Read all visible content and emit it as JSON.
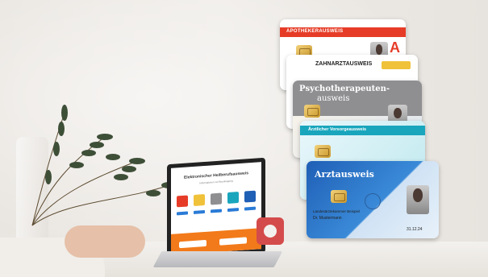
{
  "cards": {
    "apotheker": {
      "title": "APOTHEKERAUSWEIS",
      "logo": "A"
    },
    "zahnarzt": {
      "title": "ZAHNARZTAUSWEIS"
    },
    "psychotherapeut": {
      "title_line1": "Psychotherapeuten-",
      "title_line2": "ausweis"
    },
    "vorsorge": {
      "title": "Ärztlicher Vorsorgeausweis"
    },
    "arzt": {
      "title": "Arztausweis",
      "name_line1": "Landesärztekammer Beispiel",
      "name_line2": "Dr. Mustermann",
      "date": "31.12.24"
    }
  },
  "laptop_screen": {
    "headline": "Elektronischer Heilberufsausweis",
    "subline": "Informationen zur Beantragung"
  },
  "colors": {
    "apotheker_red": "#e63c27",
    "arzt_blue": "#1f5fb6",
    "vorsorge_teal": "#19a6bd",
    "laptop_orange": "#f27a1a"
  },
  "icons": [
    "smartcard-chip-icon",
    "pharmacy-a-icon",
    "caduceus-seal-icon"
  ]
}
